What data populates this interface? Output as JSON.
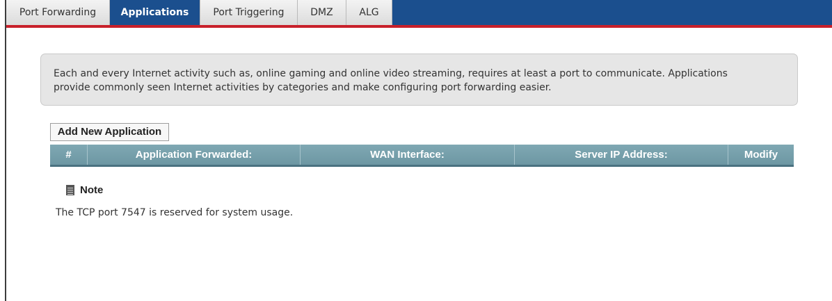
{
  "tabs": [
    {
      "label": "Port Forwarding",
      "active": false
    },
    {
      "label": "Applications",
      "active": true
    },
    {
      "label": "Port Triggering",
      "active": false
    },
    {
      "label": "DMZ",
      "active": false
    },
    {
      "label": "ALG",
      "active": false
    }
  ],
  "info": {
    "line1": "Each and every Internet activity such as, online gaming and online video streaming, requires at least a port to communicate. Applications",
    "line2": "provide commonly seen Internet activities by categories and make configuring port forwarding easier."
  },
  "add_button_label": "Add New Application",
  "table": {
    "columns": [
      "#",
      "Application Forwarded:",
      "WAN Interface:",
      "Server IP Address:",
      "Modify"
    ],
    "rows": []
  },
  "note": {
    "title": "Note",
    "text": "The TCP port 7547 is reserved for system usage."
  },
  "colors": {
    "tab_active_bg": "#1b4f8e",
    "tab_underline": "#c8202a",
    "table_header_bg": "#7fa8b3",
    "info_box_bg": "#e6e6e6"
  }
}
